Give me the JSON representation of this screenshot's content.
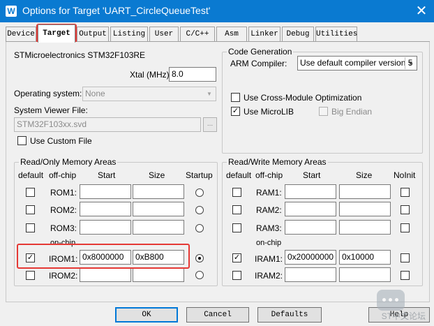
{
  "window": {
    "title": "Options for Target 'UART_CircleQueueTest'",
    "close_glyph": "✕"
  },
  "tabs": [
    {
      "label": "Device"
    },
    {
      "label": "Target"
    },
    {
      "label": "Output"
    },
    {
      "label": "Listing"
    },
    {
      "label": "User"
    },
    {
      "label": "C/C++"
    },
    {
      "label": "Asm"
    },
    {
      "label": "Linker"
    },
    {
      "label": "Debug"
    },
    {
      "label": "Utilities"
    }
  ],
  "target": {
    "device_name": "STMicroelectronics STM32F103RE",
    "xtal_label": "Xtal (MHz):",
    "xtal_value": "8.0",
    "os_label": "Operating system:",
    "os_value": "None",
    "svd_label": "System Viewer File:",
    "svd_value": "STM32F103xx.svd",
    "browse_label": "...",
    "custom_file_label": "Use Custom File"
  },
  "codegen": {
    "title": "Code Generation",
    "compiler_label": "ARM Compiler:",
    "compiler_value": "Use default compiler version 5",
    "cross_module_label": "Use Cross-Module Optimization",
    "microlib_label": "Use MicroLIB",
    "big_endian_label": "Big Endian"
  },
  "rom": {
    "title": "Read/Only Memory Areas",
    "headers": {
      "default": "default",
      "offchip": "off-chip",
      "start": "Start",
      "size": "Size",
      "startup": "Startup"
    },
    "onchip_label": "on-chip",
    "rows": [
      {
        "name": "ROM1:",
        "start": "",
        "size": "",
        "default": false,
        "startup": false
      },
      {
        "name": "ROM2:",
        "start": "",
        "size": "",
        "default": false,
        "startup": false
      },
      {
        "name": "ROM3:",
        "start": "",
        "size": "",
        "default": false,
        "startup": false
      },
      {
        "name": "IROM1:",
        "start": "0x8000000",
        "size": "0xB800",
        "default": true,
        "startup": true
      },
      {
        "name": "IROM2:",
        "start": "",
        "size": "",
        "default": false,
        "startup": false
      }
    ]
  },
  "ram": {
    "title": "Read/Write Memory Areas",
    "headers": {
      "default": "default",
      "offchip": "off-chip",
      "start": "Start",
      "size": "Size",
      "noinit": "NoInit"
    },
    "onchip_label": "on-chip",
    "rows": [
      {
        "name": "RAM1:",
        "start": "",
        "size": "",
        "default": false,
        "noinit": false
      },
      {
        "name": "RAM2:",
        "start": "",
        "size": "",
        "default": false,
        "noinit": false
      },
      {
        "name": "RAM3:",
        "start": "",
        "size": "",
        "default": false,
        "noinit": false
      },
      {
        "name": "IRAM1:",
        "start": "0x20000000",
        "size": "0x10000",
        "default": true,
        "noinit": false
      },
      {
        "name": "IRAM2:",
        "start": "",
        "size": "",
        "default": false,
        "noinit": false
      }
    ]
  },
  "buttons": {
    "ok": "OK",
    "cancel": "Cancel",
    "defaults": "Defaults",
    "help": "Help"
  },
  "watermark": {
    "text": "ST中文论坛"
  },
  "colors": {
    "titlebar": "#0a7ad1",
    "highlight": "#e53935"
  }
}
